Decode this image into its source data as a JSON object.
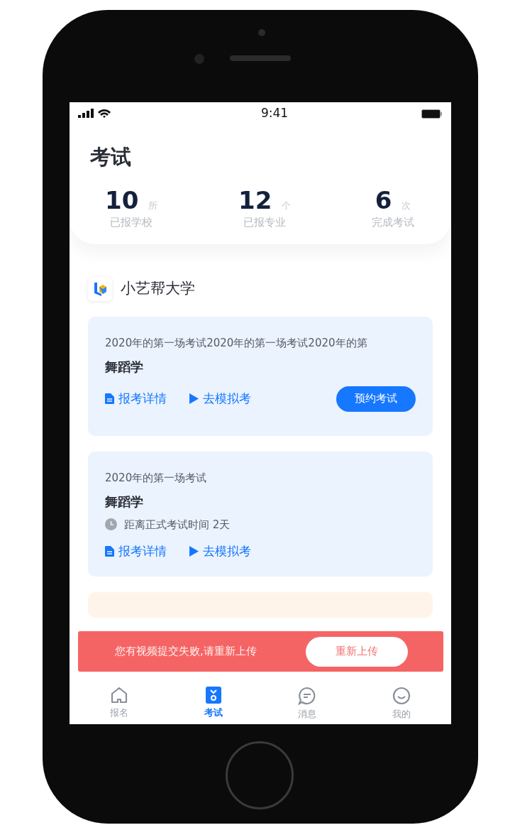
{
  "status_bar": {
    "time": "9:41"
  },
  "title": "考试",
  "stats": [
    {
      "value": "10",
      "unit": "所",
      "label": "已报学校"
    },
    {
      "value": "12",
      "unit": "个",
      "label": "已报专业"
    },
    {
      "value": "6",
      "unit": "次",
      "label": "完成考试"
    }
  ],
  "school": {
    "name": "小艺帮大学"
  },
  "exams": [
    {
      "kind": "standard",
      "title": "2020年的第一场考试2020年的第一场考试2020年的第",
      "subject": "舞蹈学",
      "links": [
        {
          "kind": "details",
          "label": "报考详情"
        },
        {
          "kind": "mock",
          "label": "去模拟考"
        }
      ],
      "button": "预约考试"
    },
    {
      "kind": "standard",
      "title": "2020年的第一场考试",
      "subject": "舞蹈学",
      "countdown": "距离正式考试时间 2天",
      "links": [
        {
          "kind": "details",
          "label": "报考详情"
        },
        {
          "kind": "mock",
          "label": "去模拟考"
        }
      ]
    },
    {
      "kind": "ongoing"
    }
  ],
  "banner": {
    "message": "您有视频提交失败,请重新上传",
    "button": "重新上传"
  },
  "tabs": [
    {
      "label": "报名",
      "selected": false
    },
    {
      "label": "考试",
      "selected": true
    },
    {
      "label": "消息",
      "selected": false
    },
    {
      "label": "我的",
      "selected": false
    }
  ]
}
